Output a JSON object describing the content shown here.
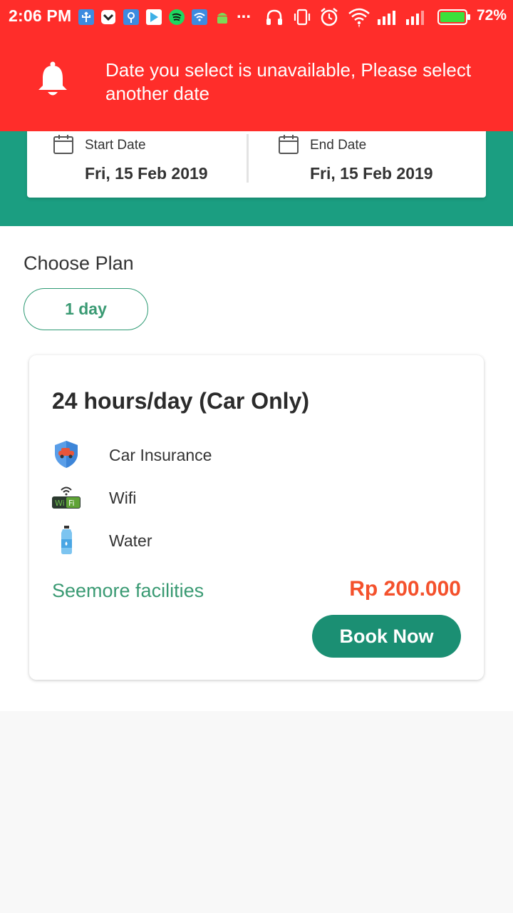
{
  "status_bar": {
    "time": "2:06 PM",
    "overflow": "...",
    "battery_percent": "72%",
    "notification_icons": [
      "usb-icon",
      "vpn-icon",
      "maps-icon",
      "play-store-icon",
      "spotify-icon",
      "wifi-app-icon",
      "android-icon"
    ],
    "system_icons": [
      "headphones-icon",
      "vibrate-icon",
      "alarm-icon",
      "wifi-icon",
      "signal-icon",
      "signal-icon-2",
      "battery-icon"
    ]
  },
  "alert": {
    "message": "Date you select is unavailable, Please select another date",
    "icon": "bell-icon",
    "color": "#ff2d2a"
  },
  "dates": {
    "start_label": "Start Date",
    "start_value": "Fri, 15 Feb 2019",
    "end_label": "End Date",
    "end_value": "Fri, 15 Feb 2019"
  },
  "plan": {
    "heading": "Choose Plan",
    "selected_chip": "1 day",
    "card": {
      "title": "24 hours/day (Car Only)",
      "facilities": [
        {
          "icon": "car-insurance-shield-icon",
          "label": "Car Insurance"
        },
        {
          "icon": "wifi-icon",
          "label": "Wifi"
        },
        {
          "icon": "water-bottle-icon",
          "label": "Water"
        }
      ],
      "seemore_label": "Seemore facilities",
      "price": "Rp 200.000",
      "book_label": "Book Now"
    }
  },
  "colors": {
    "brand_green": "#1b9e81",
    "accent_text_green": "#3a9a73",
    "price_orange": "#f4512c",
    "button_green": "#1b8f73"
  }
}
